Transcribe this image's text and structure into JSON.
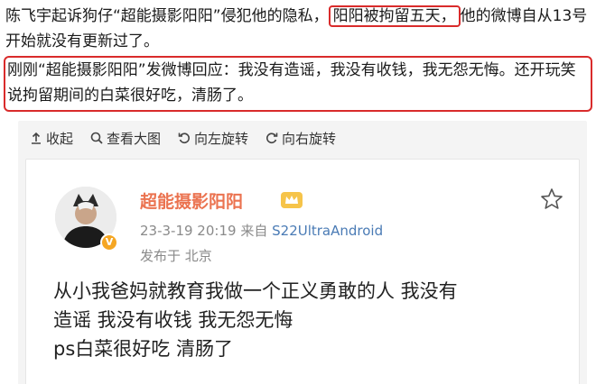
{
  "article": {
    "para1_pre": "陈飞宇起诉狗仔“超能摄影阳阳”侵犯他的隐私，",
    "para1_highlight": "阳阳被拘留五天，",
    "para1_post": "他的微博自从13号开始就没有更新过了。",
    "para2": "刚刚“超能摄影阳阳”发微博回应：我没有造谣，我没有收钱，我无怨无悔。还开玩笑说拘留期间的白菜很好吃，清肠了。"
  },
  "toolbar": {
    "collapse_label": "收起",
    "view_large_label": "查看大图",
    "rotate_left_label": "向左旋转",
    "rotate_right_label": "向右旋转"
  },
  "post": {
    "username": "超能摄影阳阳",
    "time": "23-3-19 20:19",
    "source_prefix": "来自",
    "device": "S22UltraAndroid",
    "location": "发布于 北京",
    "verified_badge": "V",
    "lines": [
      "从小我爸妈就教育我做一个正义勇敢的人 我没有",
      "造谣 我没有收钱 我无怨无悔",
      "ps白菜很好吃 清肠了"
    ]
  },
  "colors": {
    "highlight_border": "#d92b2b",
    "username": "#eb7350",
    "meta": "#8a8a8a",
    "device_link": "#4a7bb5",
    "verified": "#f5a623"
  },
  "icons": [
    "collapse-icon",
    "zoom-icon",
    "rotate-left-icon",
    "rotate-right-icon",
    "crown-icon",
    "star-icon"
  ]
}
